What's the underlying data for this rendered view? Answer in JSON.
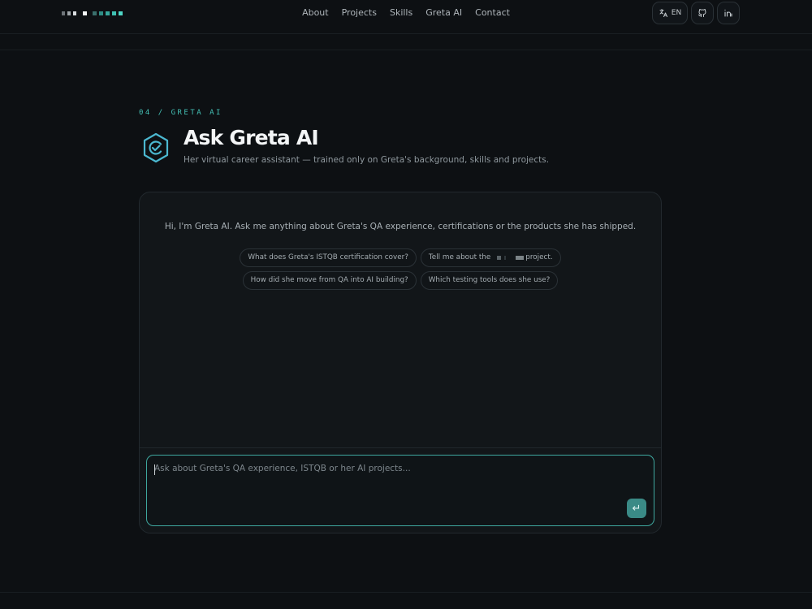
{
  "nav": {
    "links": [
      "About",
      "Projects",
      "Skills",
      "Greta AI",
      "Contact"
    ],
    "language": "EN",
    "icons": [
      "translate-icon",
      "github-icon",
      "linkedin-icon"
    ]
  },
  "section": {
    "tag": "04 / GRETA AI",
    "title": "Ask Greta AI",
    "subtitle": "Her virtual career assistant — trained only on Greta's background, skills and projects."
  },
  "chat": {
    "greeting": "Hi, I'm Greta AI. Ask me anything about Greta's QA experience, certifications or the products she has shipped.",
    "suggestions": [
      "What does Greta's ISTQB certification cover?",
      "Tell me about the",
      "project.",
      "How did she move from QA into AI building?",
      "Which testing tools does she use?"
    ],
    "input_placeholder": "Ask about Greta's QA experience, ISTQB or her AI projects...",
    "send_icon": "↵"
  },
  "colors": {
    "accent": "#44c0b5",
    "background": "#0d1013",
    "panel": "#121619",
    "send_button": "#3a8a86"
  }
}
